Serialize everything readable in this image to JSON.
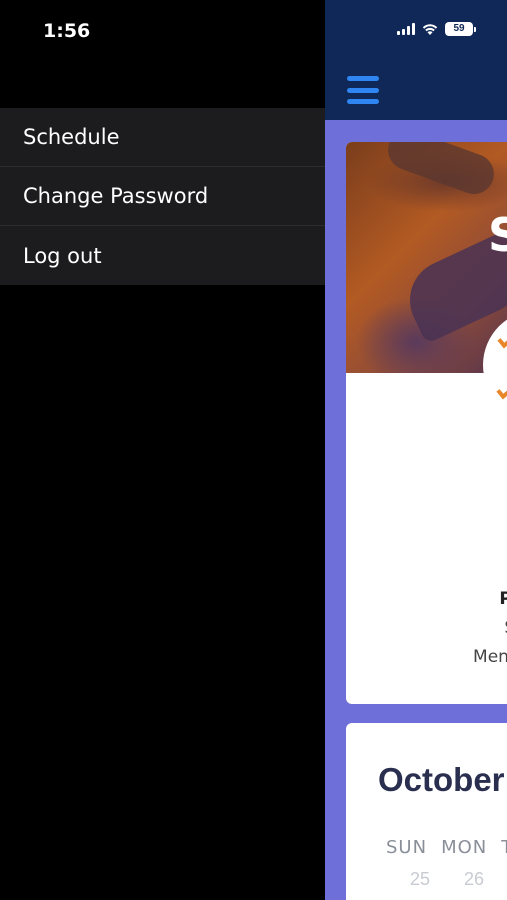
{
  "status_bar": {
    "time": "1:56",
    "battery": "59",
    "icons": [
      "signal-icon",
      "wifi-icon",
      "battery-icon"
    ]
  },
  "drawer": {
    "items": [
      {
        "label": "Schedule"
      },
      {
        "label": "Change Password"
      },
      {
        "label": "Log out"
      }
    ]
  },
  "app": {
    "header_icon": "hamburger-icon",
    "hero_text": "S",
    "card": {
      "line1": "Pri",
      "line2": "Su",
      "line3": "Mento"
    },
    "calendar": {
      "month": "October",
      "days": [
        "SUN",
        "MON",
        "T"
      ],
      "dates": [
        "25",
        "26"
      ]
    }
  },
  "colors": {
    "header_bg": "#102857",
    "app_bg": "#6e6fd8",
    "accent": "#2f86f2",
    "drawer_bg": "#1c1c1e"
  }
}
